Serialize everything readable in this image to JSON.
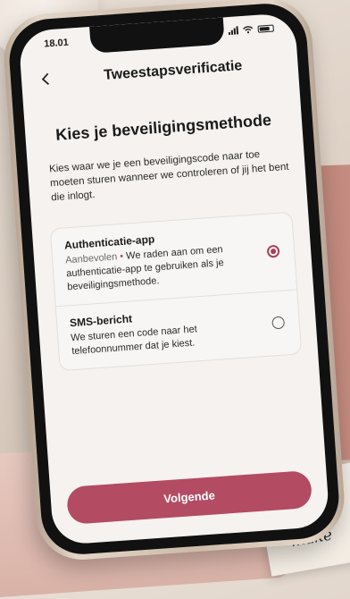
{
  "status_bar": {
    "time": "18.01"
  },
  "nav": {
    "back_icon": "chevron-left-icon",
    "title": "Tweestapsverificatie"
  },
  "main": {
    "heading": "Kies je beveiligingsmethode",
    "description": "Kies waar we je een beveiligingscode naar toe moeten sturen wanneer we controleren of jij het bent die inlogt.",
    "options": [
      {
        "title": "Authenticatie-app",
        "recommended": "Aanbevolen",
        "separator": "•",
        "body": "We raden aan om een authenticatie-app te gebruiken als je beveiligingsmethode.",
        "selected": true
      },
      {
        "title": "SMS-bericht",
        "body": "We sturen een code naar het telefoonnummer dat je kiest.",
        "selected": false
      }
    ],
    "cta_label": "Volgende"
  },
  "background": {
    "card_text": "Kleine\nmake"
  },
  "colors": {
    "accent": "#b34b63",
    "screen_bg": "#f5f2ef"
  }
}
